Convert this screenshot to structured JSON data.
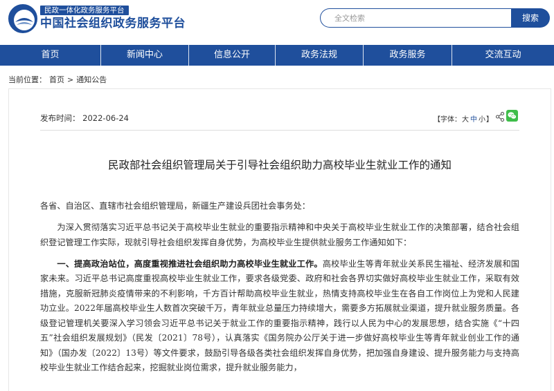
{
  "header": {
    "badge": "民政一体化政务服务平台",
    "title": "中国社会组织政务服务平台",
    "search_placeholder": "全文检索",
    "search_button": "搜索"
  },
  "nav": {
    "items": [
      "首页",
      "新闻中心",
      "信息公开",
      "政务法规",
      "政务服务",
      "交流互动"
    ]
  },
  "breadcrumb": {
    "prefix": "当前位置：",
    "home": "首页",
    "sep": ">",
    "current": "通知公告"
  },
  "article": {
    "date_label": "发布时间：",
    "date": "2022-06-24",
    "font_open": "【字体：",
    "font_large": "大",
    "font_medium": "中",
    "font_small": "小",
    "font_close": "】",
    "title": "民政部社会组织管理局关于引导社会组织助力高校毕业生就业工作的通知",
    "salutation": "各省、自治区、直辖市社会组织管理局，新疆生产建设兵团社会事务处：",
    "intro": "为深入贯彻落实习近平总书记关于高校毕业生就业的重要指示精神和中央关于高校毕业生就业工作的决策部署，结合社会组织登记管理工作实际，现就引导社会组织发挥自身优势，为高校毕业生提供就业服务工作通知如下：",
    "section1_heading": "一、提高政治站位，高度重视推进社会组织助力高校毕业生就业工作。",
    "section1_body": "高校毕业生等青年就业关系民生福祉、经济发展和国家未来。习近平总书记高度重视高校毕业生就业工作，要求各级党委、政府和社会各界切实做好高校毕业生就业工作，采取有效措施，克服新冠肺炎疫情带来的不利影响，千方百计帮助高校毕业生就业，热情支持高校毕业生在各自工作岗位上为党和人民建功立业。2022年届高校毕业生人数首次突破千万，青年就业总量压力持续增大，需要多方拓展就业渠道，提升就业服务质量。各级登记管理机关要深入学习领会习近平总书记关于就业工作的重要指示精神，践行以人民为中心的发展思想，结合实施《“十四五”社会组织发展规划》（民发〔2021〕78号），认真落实《国务院办公厅关于进一步做好高校毕业生等青年就业创业工作的通知》（国办发〔2022〕13号）等文件要求，鼓励引导各级各类社会组织发挥自身优势，把加强自身建设、提升服务能力与支持高校毕业生就业工作结合起来，挖掘就业岗位需求，提升就业服务能力，"
  },
  "colors": {
    "brand": "#1f4f9c",
    "wechat": "#3ebd49"
  }
}
